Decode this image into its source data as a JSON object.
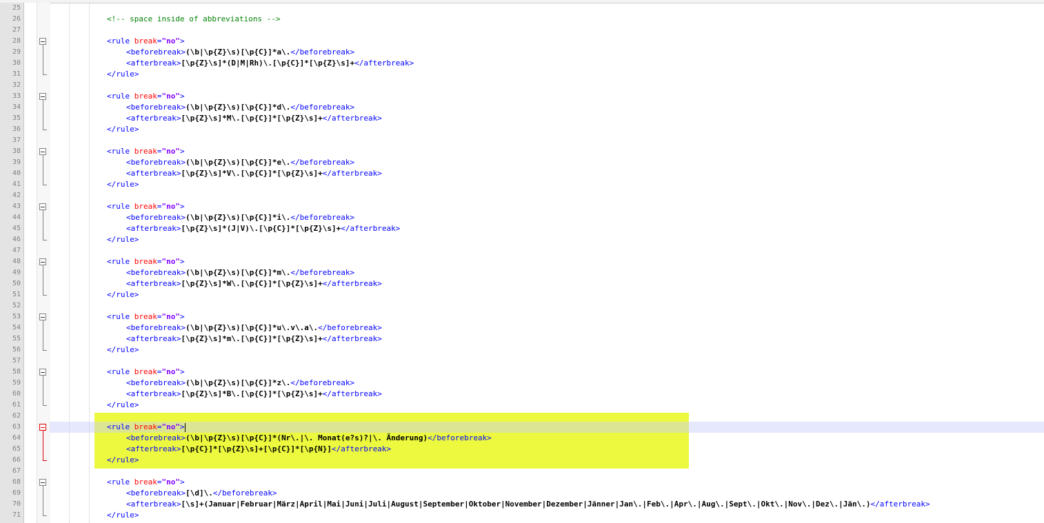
{
  "editor": {
    "colors": {
      "tag": "#0000ff",
      "attribute": "#ff0000",
      "attribute_value": "#8000ff",
      "comment": "#008000",
      "highlight": "#e8f814",
      "current_line": "#e8e8fa"
    },
    "lines": [
      {
        "n": "25",
        "parts": []
      },
      {
        "n": "26",
        "parts": [
          {
            "t": "<!-- space inside of abbreviations -->",
            "c": "cmt"
          }
        ]
      },
      {
        "n": "27",
        "parts": []
      },
      {
        "n": "28",
        "parts": [
          {
            "t": "<rule ",
            "c": "tag"
          },
          {
            "t": "break",
            "c": "attr"
          },
          {
            "t": "=",
            "c": "tag"
          },
          {
            "t": "\"no\"",
            "c": "val"
          },
          {
            "t": ">",
            "c": "tag"
          }
        ]
      },
      {
        "n": "29",
        "indent": true,
        "parts": [
          {
            "t": "<beforebreak>",
            "c": "tag"
          },
          {
            "t": "(\\b|\\p{Z}\\s)[\\p{C}]*a\\.",
            "c": "txt"
          },
          {
            "t": "</beforebreak>",
            "c": "tag"
          }
        ]
      },
      {
        "n": "30",
        "indent": true,
        "parts": [
          {
            "t": "<afterbreak>",
            "c": "tag"
          },
          {
            "t": "[\\p{Z}\\s]*(D|M|Rh)\\.[\\p{C}]*[\\p{Z}\\s]+",
            "c": "txt"
          },
          {
            "t": "</afterbreak>",
            "c": "tag"
          }
        ]
      },
      {
        "n": "31",
        "parts": [
          {
            "t": "</rule>",
            "c": "tag"
          }
        ]
      },
      {
        "n": "32",
        "parts": []
      },
      {
        "n": "33",
        "parts": [
          {
            "t": "<rule ",
            "c": "tag"
          },
          {
            "t": "break",
            "c": "attr"
          },
          {
            "t": "=",
            "c": "tag"
          },
          {
            "t": "\"no\"",
            "c": "val"
          },
          {
            "t": ">",
            "c": "tag"
          }
        ]
      },
      {
        "n": "34",
        "indent": true,
        "parts": [
          {
            "t": "<beforebreak>",
            "c": "tag"
          },
          {
            "t": "(\\b|\\p{Z}\\s)[\\p{C}]*d\\.",
            "c": "txt"
          },
          {
            "t": "</beforebreak>",
            "c": "tag"
          }
        ]
      },
      {
        "n": "35",
        "indent": true,
        "parts": [
          {
            "t": "<afterbreak>",
            "c": "tag"
          },
          {
            "t": "[\\p{Z}\\s]*M\\.[\\p{C}]*[\\p{Z}\\s]+",
            "c": "txt"
          },
          {
            "t": "</afterbreak>",
            "c": "tag"
          }
        ]
      },
      {
        "n": "36",
        "parts": [
          {
            "t": "</rule>",
            "c": "tag"
          }
        ]
      },
      {
        "n": "37",
        "parts": []
      },
      {
        "n": "38",
        "parts": [
          {
            "t": "<rule ",
            "c": "tag"
          },
          {
            "t": "break",
            "c": "attr"
          },
          {
            "t": "=",
            "c": "tag"
          },
          {
            "t": "\"no\"",
            "c": "val"
          },
          {
            "t": ">",
            "c": "tag"
          }
        ]
      },
      {
        "n": "39",
        "indent": true,
        "parts": [
          {
            "t": "<beforebreak>",
            "c": "tag"
          },
          {
            "t": "(\\b|\\p{Z}\\s)[\\p{C}]*e\\.",
            "c": "txt"
          },
          {
            "t": "</beforebreak>",
            "c": "tag"
          }
        ]
      },
      {
        "n": "40",
        "indent": true,
        "parts": [
          {
            "t": "<afterbreak>",
            "c": "tag"
          },
          {
            "t": "[\\p{Z}\\s]*V\\.[\\p{C}]*[\\p{Z}\\s]+",
            "c": "txt"
          },
          {
            "t": "</afterbreak>",
            "c": "tag"
          }
        ]
      },
      {
        "n": "41",
        "parts": [
          {
            "t": "</rule>",
            "c": "tag"
          }
        ]
      },
      {
        "n": "42",
        "parts": []
      },
      {
        "n": "43",
        "parts": [
          {
            "t": "<rule ",
            "c": "tag"
          },
          {
            "t": "break",
            "c": "attr"
          },
          {
            "t": "=",
            "c": "tag"
          },
          {
            "t": "\"no\"",
            "c": "val"
          },
          {
            "t": ">",
            "c": "tag"
          }
        ]
      },
      {
        "n": "44",
        "indent": true,
        "parts": [
          {
            "t": "<beforebreak>",
            "c": "tag"
          },
          {
            "t": "(\\b|\\p{Z}\\s)[\\p{C}]*i\\.",
            "c": "txt"
          },
          {
            "t": "</beforebreak>",
            "c": "tag"
          }
        ]
      },
      {
        "n": "45",
        "indent": true,
        "parts": [
          {
            "t": "<afterbreak>",
            "c": "tag"
          },
          {
            "t": "[\\p{Z}\\s]*(J|V)\\.[\\p{C}]*[\\p{Z}\\s]+",
            "c": "txt"
          },
          {
            "t": "</afterbreak>",
            "c": "tag"
          }
        ]
      },
      {
        "n": "46",
        "parts": [
          {
            "t": "</rule>",
            "c": "tag"
          }
        ]
      },
      {
        "n": "47",
        "parts": []
      },
      {
        "n": "48",
        "parts": [
          {
            "t": "<rule ",
            "c": "tag"
          },
          {
            "t": "break",
            "c": "attr"
          },
          {
            "t": "=",
            "c": "tag"
          },
          {
            "t": "\"no\"",
            "c": "val"
          },
          {
            "t": ">",
            "c": "tag"
          }
        ]
      },
      {
        "n": "49",
        "indent": true,
        "parts": [
          {
            "t": "<beforebreak>",
            "c": "tag"
          },
          {
            "t": "(\\b|\\p{Z}\\s)[\\p{C}]*m\\.",
            "c": "txt"
          },
          {
            "t": "</beforebreak>",
            "c": "tag"
          }
        ]
      },
      {
        "n": "50",
        "indent": true,
        "parts": [
          {
            "t": "<afterbreak>",
            "c": "tag"
          },
          {
            "t": "[\\p{Z}\\s]*W\\.[\\p{C}]*[\\p{Z}\\s]+",
            "c": "txt"
          },
          {
            "t": "</afterbreak>",
            "c": "tag"
          }
        ]
      },
      {
        "n": "51",
        "parts": [
          {
            "t": "</rule>",
            "c": "tag"
          }
        ]
      },
      {
        "n": "52",
        "parts": []
      },
      {
        "n": "53",
        "parts": [
          {
            "t": "<rule ",
            "c": "tag"
          },
          {
            "t": "break",
            "c": "attr"
          },
          {
            "t": "=",
            "c": "tag"
          },
          {
            "t": "\"no\"",
            "c": "val"
          },
          {
            "t": ">",
            "c": "tag"
          }
        ]
      },
      {
        "n": "54",
        "indent": true,
        "parts": [
          {
            "t": "<beforebreak>",
            "c": "tag"
          },
          {
            "t": "(\\b|\\p{Z}\\s)[\\p{C}]*u\\.v\\.a\\.",
            "c": "txt"
          },
          {
            "t": "</beforebreak>",
            "c": "tag"
          }
        ]
      },
      {
        "n": "55",
        "indent": true,
        "parts": [
          {
            "t": "<afterbreak>",
            "c": "tag"
          },
          {
            "t": "[\\p{Z}\\s]*m\\.[\\p{C}]*[\\p{Z}\\s]+",
            "c": "txt"
          },
          {
            "t": "</afterbreak>",
            "c": "tag"
          }
        ]
      },
      {
        "n": "56",
        "parts": [
          {
            "t": "</rule>",
            "c": "tag"
          }
        ]
      },
      {
        "n": "57",
        "parts": []
      },
      {
        "n": "58",
        "parts": [
          {
            "t": "<rule ",
            "c": "tag"
          },
          {
            "t": "break",
            "c": "attr"
          },
          {
            "t": "=",
            "c": "tag"
          },
          {
            "t": "\"no\"",
            "c": "val"
          },
          {
            "t": ">",
            "c": "tag"
          }
        ]
      },
      {
        "n": "59",
        "indent": true,
        "parts": [
          {
            "t": "<beforebreak>",
            "c": "tag"
          },
          {
            "t": "(\\b|\\p{Z}\\s)[\\p{C}]*z\\.",
            "c": "txt"
          },
          {
            "t": "</beforebreak>",
            "c": "tag"
          }
        ]
      },
      {
        "n": "60",
        "indent": true,
        "parts": [
          {
            "t": "<afterbreak>",
            "c": "tag"
          },
          {
            "t": "[\\p{Z}\\s]*B\\.[\\p{C}]*[\\p{Z}\\s]+",
            "c": "txt"
          },
          {
            "t": "</afterbreak>",
            "c": "tag"
          }
        ]
      },
      {
        "n": "61",
        "parts": [
          {
            "t": "</rule>",
            "c": "tag"
          }
        ]
      },
      {
        "n": "62",
        "parts": []
      },
      {
        "n": "63",
        "current": true,
        "parts": [
          {
            "t": "<rule ",
            "c": "tag"
          },
          {
            "t": "break",
            "c": "attr"
          },
          {
            "t": "=",
            "c": "tag"
          },
          {
            "t": "\"no\"",
            "c": "val"
          },
          {
            "t": ">",
            "c": "tag"
          }
        ]
      },
      {
        "n": "64",
        "indent": true,
        "parts": [
          {
            "t": "<beforebreak>",
            "c": "tag"
          },
          {
            "t": "(\\b|\\p{Z}\\s)[\\p{C}]*(Nr\\.|\\. Monat(e?s)?|\\. Änderung)",
            "c": "txt"
          },
          {
            "t": "</beforebreak>",
            "c": "tag"
          }
        ]
      },
      {
        "n": "65",
        "indent": true,
        "parts": [
          {
            "t": "<afterbreak>",
            "c": "tag"
          },
          {
            "t": "[\\p{C}]*[\\p{Z}\\s]+[\\p{C}]*[\\p{N}]",
            "c": "txt"
          },
          {
            "t": "</afterbreak>",
            "c": "tag"
          }
        ]
      },
      {
        "n": "66",
        "parts": [
          {
            "t": "</rule>",
            "c": "tag"
          }
        ]
      },
      {
        "n": "67",
        "parts": []
      },
      {
        "n": "68",
        "parts": [
          {
            "t": "<rule ",
            "c": "tag"
          },
          {
            "t": "break",
            "c": "attr"
          },
          {
            "t": "=",
            "c": "tag"
          },
          {
            "t": "\"no\"",
            "c": "val"
          },
          {
            "t": ">",
            "c": "tag"
          }
        ]
      },
      {
        "n": "69",
        "indent": true,
        "parts": [
          {
            "t": "<beforebreak>",
            "c": "tag"
          },
          {
            "t": "[\\d]\\.",
            "c": "txt"
          },
          {
            "t": "</beforebreak>",
            "c": "tag"
          }
        ]
      },
      {
        "n": "70",
        "indent": true,
        "parts": [
          {
            "t": "<afterbreak>",
            "c": "tag"
          },
          {
            "t": "[\\s]+(Januar|Februar|März|April|Mai|Juni|Juli|August|September|Oktober|November|Dezember|Jänner|Jan\\.|Feb\\.|Apr\\.|Aug\\.|Sept\\.|Okt\\.|Nov\\.|Dez\\.|Jän\\.)",
            "c": "txt"
          },
          {
            "t": "</afterbreak>",
            "c": "tag"
          }
        ]
      },
      {
        "n": "71",
        "parts": [
          {
            "t": "</rule>",
            "c": "tag"
          }
        ]
      }
    ]
  }
}
